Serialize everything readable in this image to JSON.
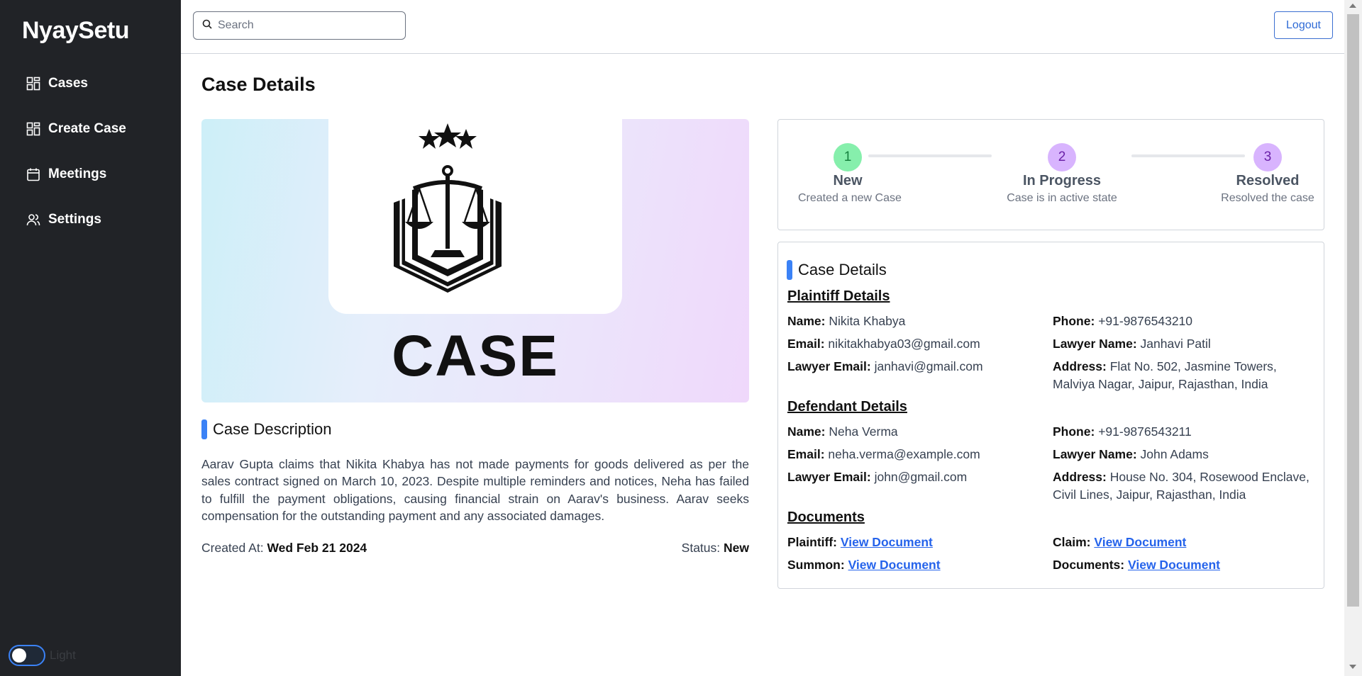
{
  "app": {
    "brand": "NyaySetu"
  },
  "sidebar": {
    "items": [
      {
        "label": "Cases",
        "icon": "grid-icon"
      },
      {
        "label": "Create Case",
        "icon": "grid-icon"
      },
      {
        "label": "Meetings",
        "icon": "calendar-icon"
      },
      {
        "label": "Settings",
        "icon": "users-icon"
      }
    ],
    "theme_label": "Light"
  },
  "topbar": {
    "search_placeholder": "Search",
    "logout_label": "Logout"
  },
  "page": {
    "title": "Case Details"
  },
  "hero": {
    "case_word": "CASE"
  },
  "description": {
    "heading": "Case Description",
    "text": "Aarav Gupta claims that Nikita Khabya has not made payments for goods delivered as per the sales contract signed on March 10, 2023. Despite multiple reminders and notices, Neha has failed to fulfill the payment obligations, causing financial strain on Aarav's business. Aarav seeks compensation for the outstanding payment and any associated damages.",
    "created_label": "Created At:",
    "created_value": "Wed Feb 21 2024",
    "status_label": "Status:",
    "status_value": "New"
  },
  "stepper": {
    "steps": [
      {
        "num": "1",
        "name": "New",
        "sub": "Created a new Case",
        "color": "#86efac",
        "text_color": "#15803d"
      },
      {
        "num": "2",
        "name": "In Progress",
        "sub": "Case is in active state",
        "color": "#d8b4fe",
        "text_color": "#6b21a8"
      },
      {
        "num": "3",
        "name": "Resolved",
        "sub": "Resolved the case",
        "color": "#d8b4fe",
        "text_color": "#6b21a8"
      }
    ]
  },
  "details": {
    "heading": "Case Details",
    "plaintiff": {
      "heading": "Plaintiff Details",
      "name_label": "Name:",
      "name": "Nikita Khabya",
      "phone_label": "Phone:",
      "phone": "+91-9876543210",
      "email_label": "Email:",
      "email": "nikitakhabya03@gmail.com",
      "lawyer_name_label": "Lawyer Name:",
      "lawyer_name": "Janhavi Patil",
      "lawyer_email_label": "Lawyer Email:",
      "lawyer_email": "janhavi@gmail.com",
      "address_label": "Address:",
      "address_line1": "Flat No. 502, Jasmine Towers,",
      "address_line2": "Malviya Nagar, Jaipur, Rajasthan, India"
    },
    "defendant": {
      "heading": "Defendant Details",
      "name_label": "Name:",
      "name": "Neha Verma",
      "phone_label": "Phone:",
      "phone": "+91-9876543211",
      "email_label": "Email:",
      "email": "neha.verma@example.com",
      "lawyer_name_label": "Lawyer Name:",
      "lawyer_name": "John Adams",
      "lawyer_email_label": "Lawyer Email:",
      "lawyer_email": "john@gmail.com",
      "address_label": "Address:",
      "address_line1": "House No. 304, Rosewood Enclave,",
      "address_line2": "Civil Lines, Jaipur, Rajasthan, India"
    },
    "documents": {
      "heading": "Documents",
      "plaintiff_label": "Plaintiff:",
      "claim_label": "Claim:",
      "summon_label": "Summon:",
      "documents_label": "Documents:",
      "link_text": "View Document"
    }
  },
  "colors": {
    "sidebar_bg": "#212327",
    "accent": "#3b82f6",
    "link": "#2563eb"
  }
}
